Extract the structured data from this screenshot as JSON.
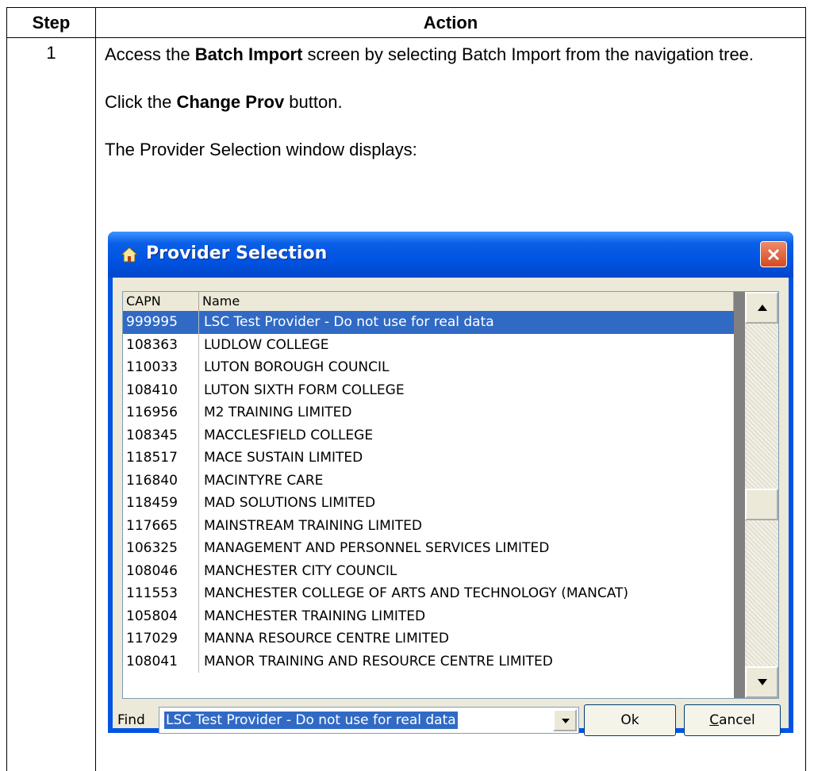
{
  "table": {
    "header_step": "Step",
    "header_action": "Action",
    "step_number": "1",
    "para1_prefix": "Access the ",
    "para1_bold": "Batch Import",
    "para1_suffix": " screen by selecting Batch Import from the navigation tree.",
    "para2_prefix": "Click the ",
    "para2_bold": "Change Prov",
    "para2_suffix": " button.",
    "para3": "The Provider Selection window displays:"
  },
  "dialog": {
    "title": "Provider Selection",
    "icons": {
      "title": "home-icon",
      "close": "close-icon"
    },
    "columns": {
      "capn": "CAPN",
      "name": "Name"
    },
    "rows": [
      {
        "capn": "999995",
        "name": "LSC Test Provider - Do not use for real data",
        "selected": true
      },
      {
        "capn": "108363",
        "name": "LUDLOW COLLEGE"
      },
      {
        "capn": "110033",
        "name": "LUTON BOROUGH COUNCIL"
      },
      {
        "capn": "108410",
        "name": "LUTON SIXTH FORM COLLEGE"
      },
      {
        "capn": "116956",
        "name": "M2 TRAINING LIMITED"
      },
      {
        "capn": "108345",
        "name": "MACCLESFIELD COLLEGE"
      },
      {
        "capn": "118517",
        "name": "MACE SUSTAIN LIMITED"
      },
      {
        "capn": "116840",
        "name": "MACINTYRE CARE"
      },
      {
        "capn": "118459",
        "name": "MAD SOLUTIONS LIMITED"
      },
      {
        "capn": "117665",
        "name": "MAINSTREAM TRAINING LIMITED"
      },
      {
        "capn": "106325",
        "name": "MANAGEMENT AND PERSONNEL SERVICES LIMITED"
      },
      {
        "capn": "108046",
        "name": "MANCHESTER CITY COUNCIL"
      },
      {
        "capn": "111553",
        "name": "MANCHESTER COLLEGE OF ARTS AND TECHNOLOGY (MANCAT)"
      },
      {
        "capn": "105804",
        "name": "MANCHESTER TRAINING LIMITED"
      },
      {
        "capn": "117029",
        "name": "MANNA RESOURCE CENTRE LIMITED"
      },
      {
        "capn": "108041",
        "name": "MANOR TRAINING AND RESOURCE CENTRE LIMITED"
      }
    ],
    "find_label": "Find",
    "find_value": "LSC Test Provider - Do not use for real data",
    "ok_label": "Ok",
    "cancel_label_first": "C",
    "cancel_label_rest": "ancel",
    "colors": {
      "titlebar": "#0054e3",
      "selection": "#316ac5",
      "dialog_bg": "#ece9d8",
      "close": "#d44a20"
    }
  }
}
